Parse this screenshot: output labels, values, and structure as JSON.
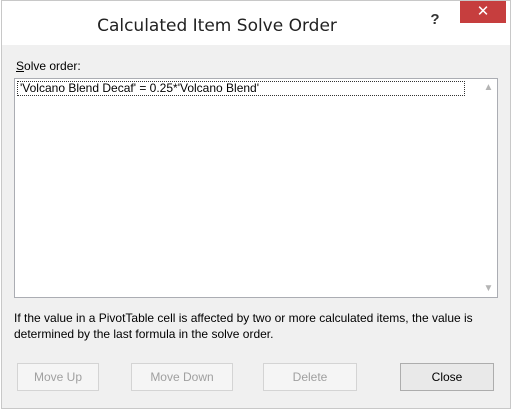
{
  "window": {
    "title": "Calculated Item Solve Order",
    "help_label": "?",
    "close_glyph": "✕"
  },
  "solve_order": {
    "label_prefix": "S",
    "label_rest": "olve order:",
    "items": [
      "'Volcano Blend Decaf' =  0.25*'Volcano Blend'"
    ]
  },
  "scrollbar": {
    "up_glyph": "▲",
    "down_glyph": "▼"
  },
  "info_text": "If the value in a PivotTable cell is affected by two or more calculated items, the value is determined by the last formula in the solve order.",
  "buttons": {
    "move_up": "Move Up",
    "move_down": "Move Down",
    "delete": "Delete",
    "close": "Close"
  },
  "colors": {
    "close_button": "#c63e3e",
    "dialog_bg": "#f0f0f0",
    "disabled_text": "#a0a0a0"
  }
}
